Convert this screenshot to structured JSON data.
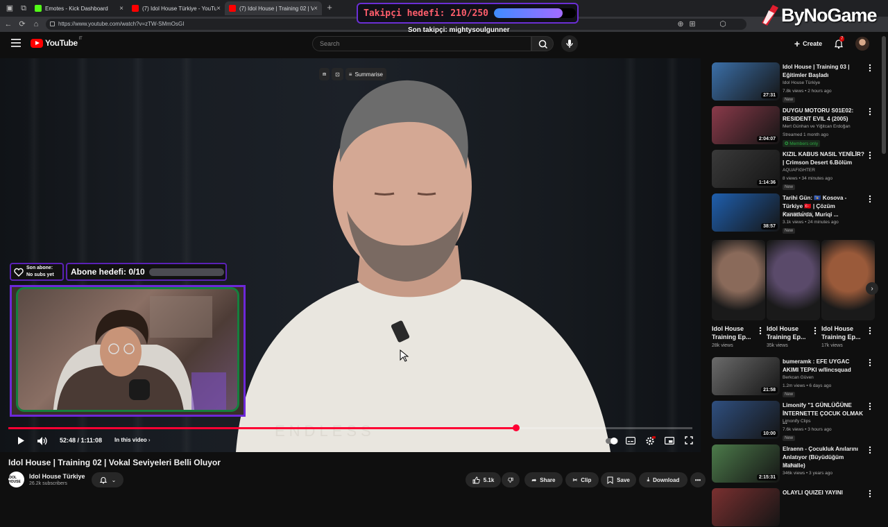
{
  "browser": {
    "tabs": [
      {
        "title": "Emotes - Kick Dashboard",
        "color": "#53fc18"
      },
      {
        "title": "(7) Idol House Türkiye - YouTube",
        "color": "#ff0000"
      },
      {
        "title": "(7) Idol House | Training 02 | V",
        "color": "#ff0000"
      }
    ],
    "url": "https://www.youtube.com/watch?v=zTW-SMmOsGI"
  },
  "overlay": {
    "follower_goal": "Takipçi hedefi: 210/250",
    "follower_goal_progress": 0.84,
    "last_follower": "Son takipçi: mightysoulgunner",
    "brand": "ByNoGame",
    "last_sub_line1": "Son abone:",
    "last_sub_line2": "No subs yet",
    "sub_goal": "Abone hedefi: 0/10",
    "sub_goal_progress": 0
  },
  "youtube": {
    "logo_text": "YouTube",
    "logo_region": "IT",
    "search_placeholder": "Search",
    "create_label": "Create",
    "notification_count": "7"
  },
  "player": {
    "summarise_label": "Summarise",
    "time": "52:48 / 1:11:08",
    "chapter": "In this video",
    "progress": 0.7423
  },
  "video": {
    "title": "Idol House | Training 02 | Vokal Seviyeleri Belli Oluyor",
    "channel": "Idol House Türkiye",
    "channel_avatar_text": "IDOL HOUSE",
    "subscribers": "26.2k subscribers",
    "likes": "5.1k",
    "share": "Share",
    "clip": "Clip",
    "save": "Save",
    "download": "Download"
  },
  "recommendations": [
    {
      "title": "Idol House | Training 03 | Eğitimler Başladı",
      "channel": "Idol House Türkiye",
      "meta": "7.8k views • 2 hours ago",
      "badge": "New",
      "duration": "27:31",
      "thumb": "#3b6fa8"
    },
    {
      "title": "DUYGU MOTORU S01E02: RESIDENT EVIL 4 (2005)",
      "channel": "Mert Günhan ve Yiğitcan Erdoğan",
      "meta": "Streamed 1 month ago",
      "badge": "Members only",
      "duration": "2:04:07",
      "thumb": "#8a3a4a"
    },
    {
      "title": "KIZIL KABUS NASIL YENİLİR? | Crimson Desert 6.Bölüm",
      "channel": "AQUAFIGHTER",
      "meta": "8 views • 34 minutes ago",
      "badge": "New",
      "duration": "1:14:36",
      "thumb": "#3a3a3a"
    },
    {
      "title": "Tarihi Gün: 🇽🇰 Kosova - Türkiye 🇹🇷 | Çözüm Kanatlarda, Muriqi ...",
      "channel": "Socrates Dergi",
      "meta": "3.1k views • 24 minutes ago",
      "badge": "New",
      "duration": "38:57",
      "thumb": "#1f5fae"
    },
    {
      "title": "bumeramk : EFE UYGAC AKIMI TEPKI w/lincsquad",
      "channel": "Berkcan Güven",
      "meta": "1.2m views • 6 days ago",
      "badge": "New",
      "duration": "21:58",
      "thumb": "#6b6b6b"
    },
    {
      "title": "Limonify \"1 GÜNLÜĞÜNE İNTERNETTE ÇOCUK OLMAK ...",
      "channel": "Limonify Clips",
      "meta": "7.6k views • 3 hours ago",
      "badge": "New",
      "duration": "10:00",
      "thumb": "#2f4f7f"
    },
    {
      "title": "Elraenn - Çocukluk Anılarını Anlatıyor (Büyüdüğüm Mahalle)",
      "channel": "Montajer",
      "meta": "346k views • 3 years ago",
      "badge": "",
      "duration": "2:15:31",
      "thumb": "#4c7a4a"
    },
    {
      "title": "OLAYLI QUIZEI YAYINI",
      "channel": "",
      "meta": "",
      "badge": "",
      "duration": "",
      "thumb": "#7a3030"
    }
  ],
  "shorts": [
    {
      "title": "Idol House Training Ep...",
      "views": "28k views",
      "thumb": "#8a6a5a"
    },
    {
      "title": "Idol House Training Ep...",
      "views": "35k views",
      "thumb": "#5a4a6a"
    },
    {
      "title": "Idol House Training Ep...",
      "views": "17k views",
      "thumb": "#9a5a3a"
    }
  ]
}
